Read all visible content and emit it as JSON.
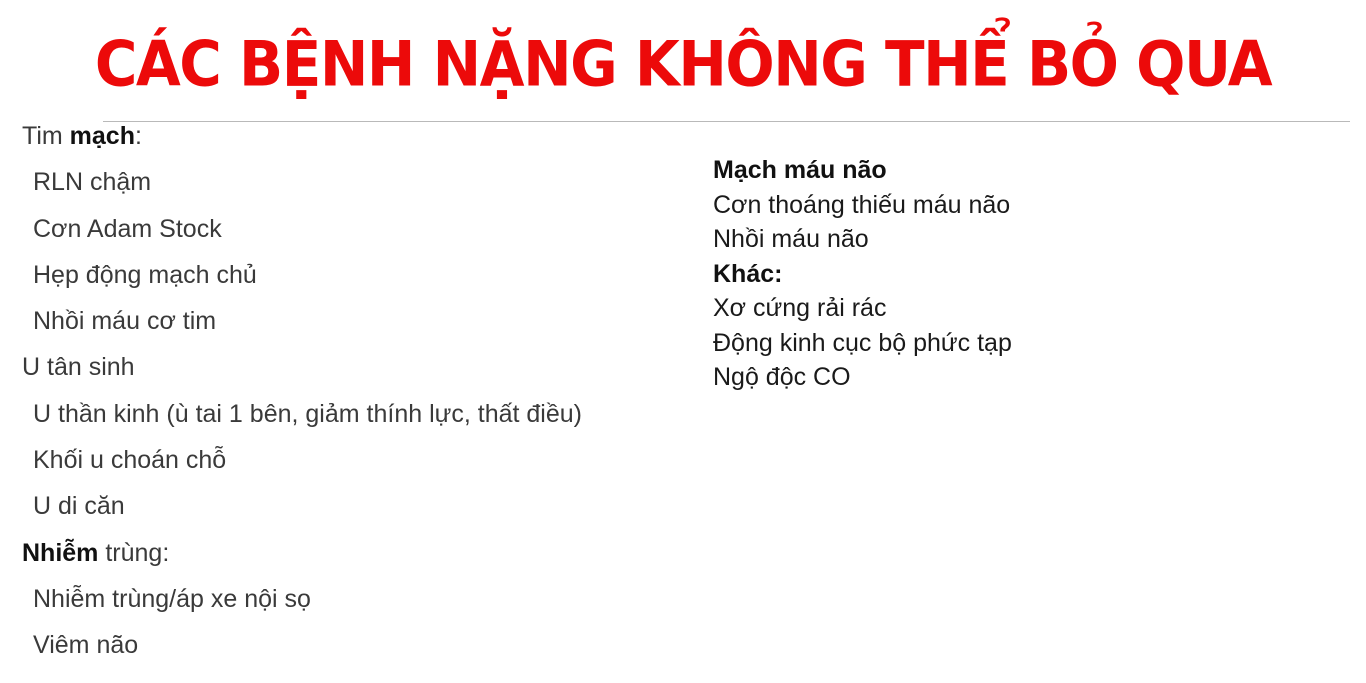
{
  "title": "CÁC BỆNH NẶNG KHÔNG THỂ BỎ QUA",
  "left": {
    "cardio": {
      "prefix": "Tim ",
      "bold": "mạch",
      "suffix": ":"
    },
    "cardio_items": [
      "RLN chậm",
      "Cơn Adam Stock",
      "Hẹp động mạch chủ",
      "Nhồi máu cơ tim"
    ],
    "neoplasm_label": "U tân sinh",
    "neoplasm_items": [
      "U thần kinh (ù tai 1 bên, giảm thính lực, thất điều)",
      "Khối u choán chỗ",
      "U di căn"
    ],
    "infection": {
      "bold": "Nhiễm",
      "suffix": " trùng:"
    },
    "infection_items": [
      "Nhiễm trùng/áp xe nội sọ",
      "Viêm não"
    ]
  },
  "right": {
    "cerebro_label": "Mạch máu não",
    "cerebro_items": [
      "Cơn thoáng thiếu máu não",
      "Nhồi máu não"
    ],
    "other_label": "Khác:",
    "other_items": [
      "Xơ cứng rải rác",
      "Động kinh cục bộ phức tạp",
      "Ngộ độc CO"
    ]
  },
  "colors": {
    "title": "#ec0a0a",
    "text": "#3a3a3a",
    "rule": "#b9b9b9"
  }
}
